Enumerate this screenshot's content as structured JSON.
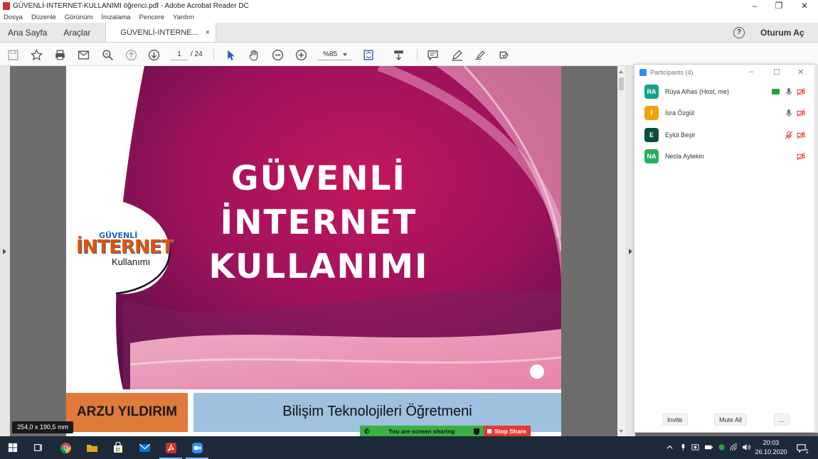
{
  "window": {
    "title": "GÜVENLİ-INTERNET-KULLANIMI öğrenci.pdf - Adobe Acrobat Reader DC",
    "minimize": "–",
    "restore": "❐",
    "close": "✕"
  },
  "menu": [
    "Dosya",
    "Düzenle",
    "Görünüm",
    "İmzalama",
    "Pencere",
    "Yardım"
  ],
  "tabs": {
    "home": "Ana Sayfa",
    "tools": "Araçlar",
    "document": "GÜVENLİ-INTERNE...",
    "document_close": "×",
    "help": "?",
    "signin": "Oturum Aç"
  },
  "toolbar": {
    "page_current": "1",
    "page_total": "/ 24",
    "zoom": "%85"
  },
  "document": {
    "cover_title_lines": [
      "GÜVENLİ",
      "İNTERNET",
      "KULLANIMI"
    ],
    "logo_top": "GÜVENLİ",
    "logo_main": "İNTERNET",
    "logo_sub": "Kullanımı",
    "author": "ARZU YILDIRIM",
    "role": "Bilişim Teknolojileri Öğretmeni"
  },
  "page_size_tooltip": "254,0 x 190,5 mm",
  "screen_share": {
    "status": "You are screen sharing",
    "stop": "Stop Share"
  },
  "participants_panel": {
    "title": "Participants (4)",
    "participants": [
      {
        "initials": "RA",
        "name": "Rüya Alhas (Host, me)",
        "color": "#16a085",
        "sharing": true,
        "mic": "on",
        "video": "off"
      },
      {
        "initials": "İ",
        "name": "İsra Özgül",
        "color": "#f0a30a",
        "sharing": false,
        "mic": "on",
        "video": "off"
      },
      {
        "initials": "E",
        "name": "Eylül Beşir",
        "color": "#0b4d3c",
        "sharing": false,
        "mic": "muted",
        "video": "off"
      },
      {
        "initials": "NA",
        "name": "Necla Aytekin",
        "color": "#27ae60",
        "sharing": false,
        "mic": "none",
        "video": "off"
      }
    ],
    "invite": "Invite",
    "mute_all": "Mute All",
    "more": "..."
  },
  "taskbar": {
    "time": "20:03",
    "date": "26.10.2020",
    "notifications": "1"
  }
}
